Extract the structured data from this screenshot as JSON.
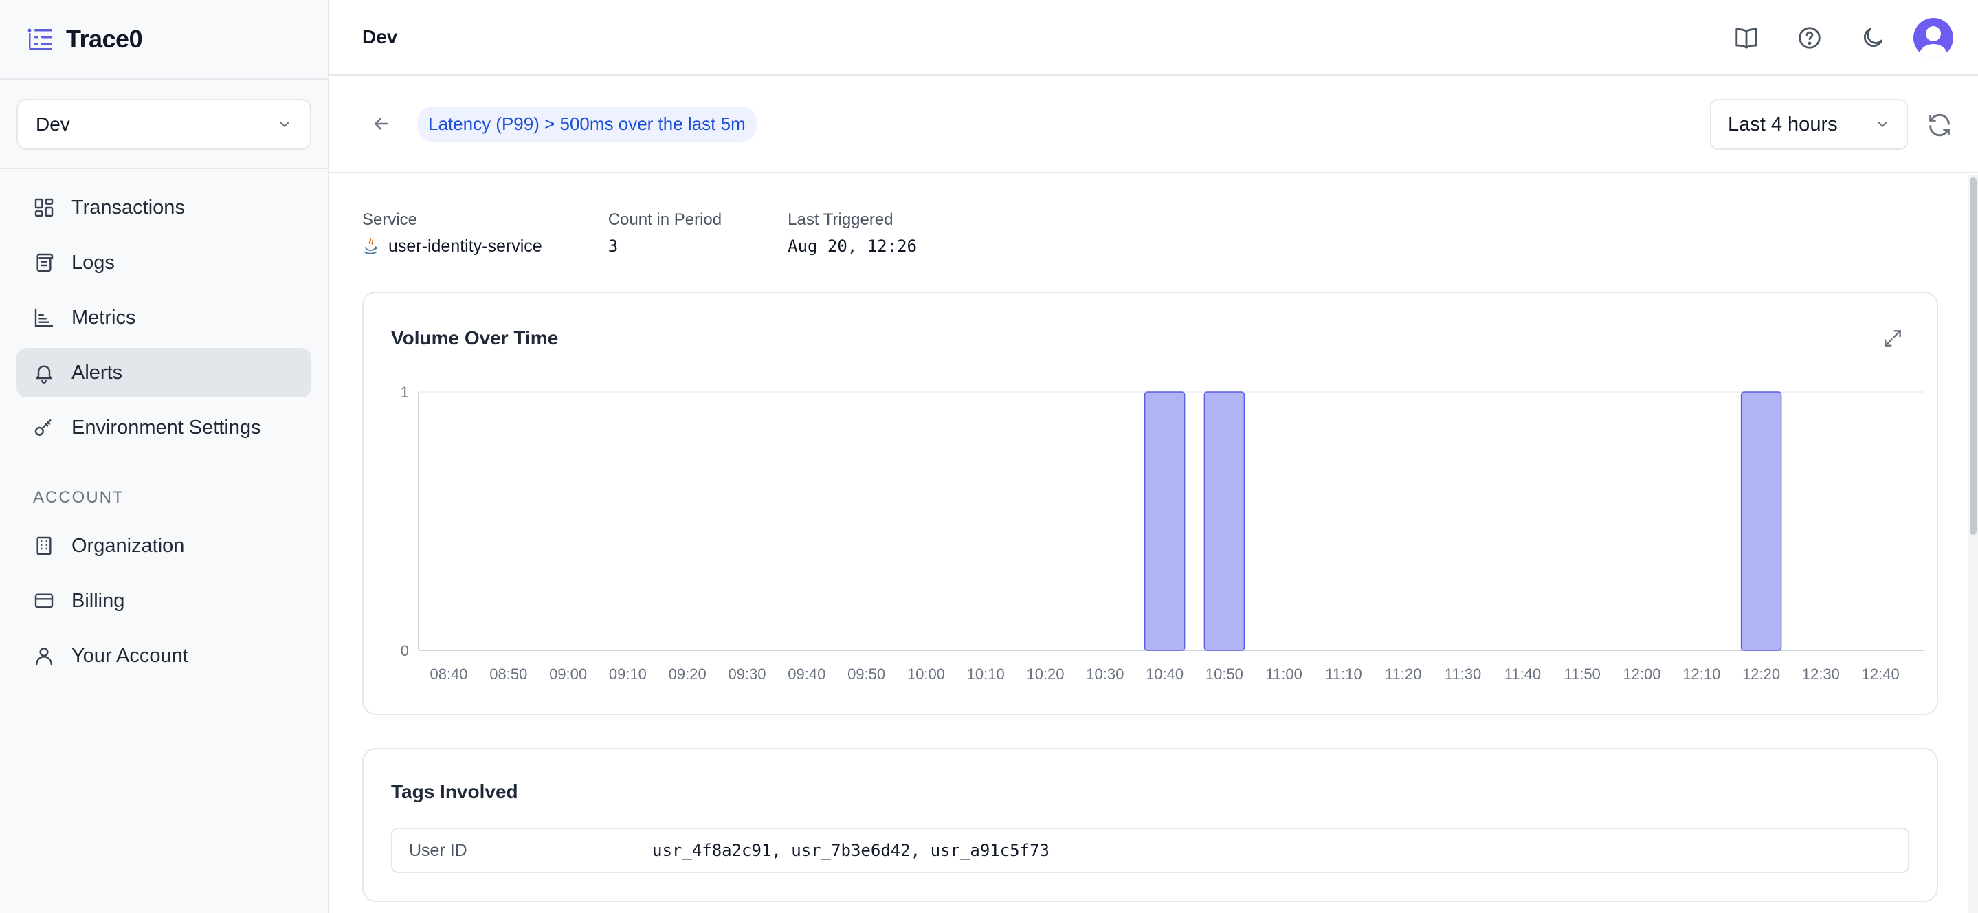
{
  "brand": {
    "name": "Trace0"
  },
  "sidebar": {
    "env_select": "Dev",
    "items": [
      {
        "label": "Transactions",
        "icon": "grid-icon"
      },
      {
        "label": "Logs",
        "icon": "scroll-icon"
      },
      {
        "label": "Metrics",
        "icon": "bar-chart-icon"
      },
      {
        "label": "Alerts",
        "icon": "bell-icon",
        "active": true
      },
      {
        "label": "Environment Settings",
        "icon": "key-icon"
      }
    ],
    "account_label": "ACCOUNT",
    "account_items": [
      {
        "label": "Organization",
        "icon": "building-icon"
      },
      {
        "label": "Billing",
        "icon": "credit-card-icon"
      },
      {
        "label": "Your Account",
        "icon": "user-icon"
      }
    ]
  },
  "header": {
    "title": "Dev",
    "icons": [
      "book-icon",
      "help-icon",
      "moon-icon",
      "avatar"
    ]
  },
  "alert": {
    "title": "Latency (P99) > 500ms over the last 5m",
    "time_range": "Last 4 hours"
  },
  "info": {
    "service_label": "Service",
    "service_value": "user-identity-service",
    "count_label": "Count in Period",
    "count_value": "3",
    "last_label": "Last Triggered",
    "last_value": "Aug 20, 12:26"
  },
  "chart_card": {
    "title": "Volume Over Time"
  },
  "chart_data": {
    "type": "bar",
    "categories": [
      "08:40",
      "08:50",
      "09:00",
      "09:10",
      "09:20",
      "09:30",
      "09:40",
      "09:50",
      "10:00",
      "10:10",
      "10:20",
      "10:30",
      "10:40",
      "10:50",
      "11:00",
      "11:10",
      "11:20",
      "11:30",
      "11:40",
      "11:50",
      "12:00",
      "12:10",
      "12:20",
      "12:30",
      "12:40"
    ],
    "values": [
      0,
      0,
      0,
      0,
      0,
      0,
      0,
      0,
      0,
      0,
      0,
      0,
      1,
      1,
      0,
      0,
      0,
      0,
      0,
      0,
      0,
      0,
      1,
      0,
      0
    ],
    "yticks": [
      "0",
      "1"
    ],
    "ylim": [
      0,
      1
    ],
    "grid": false,
    "bar_color": "#b1b3f5",
    "bar_stroke": "#5b5fe0"
  },
  "tags": {
    "title": "Tags Involved",
    "rows": [
      {
        "key": "User ID",
        "value": "usr_4f8a2c91, usr_7b3e6d42, usr_a91c5f73"
      }
    ]
  },
  "colors": {
    "accent": "#5b5fe0",
    "pill_bg": "#eef2ff",
    "pill_text": "#1d4ed8"
  }
}
